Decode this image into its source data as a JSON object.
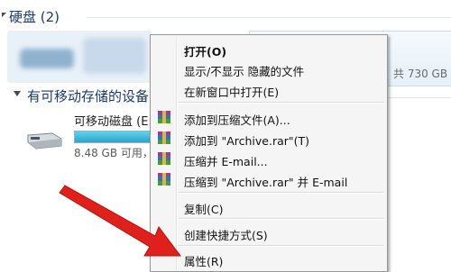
{
  "hard_disks": {
    "header": "硬盘 (2)",
    "drive_size_text": "共 730 GB"
  },
  "removable": {
    "header": "有可移动存储的设备 (1)",
    "drive_label": "可移动磁盘 (E:)",
    "drive_info": "8.48 GB 可用，",
    "usage_fraction": 0.99
  },
  "context_menu": {
    "open": "打开(O)",
    "show_hide": "显示/不显示 隐藏的文件",
    "open_new_window": "在新窗口中打开(E)",
    "add_to_archive": "添加到压缩文件(A)...",
    "add_to_rar": "添加到 \"Archive.rar\"(T)",
    "compress_email": "压缩并 E-mail...",
    "compress_rar_email": "压缩到 \"Archive.rar\" 并 E-mail",
    "copy": "复制(C)",
    "create_shortcut": "创建快捷方式(S)",
    "properties": "属性(R)"
  },
  "colors": {
    "header_text": "#1a3a6b",
    "annotation_arrow": "#e0201b",
    "usage_bar": "#2aa5c8"
  }
}
